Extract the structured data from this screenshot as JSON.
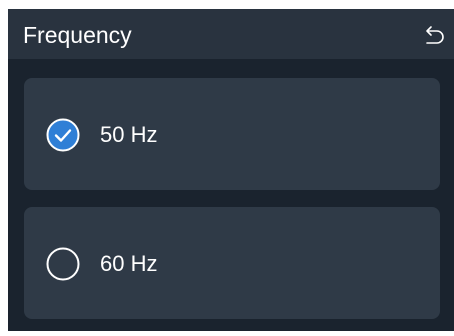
{
  "header": {
    "title": "Frequency",
    "back_icon": "back-arrow-icon"
  },
  "options": [
    {
      "label": "50 Hz",
      "selected": true
    },
    {
      "label": "60 Hz",
      "selected": false
    }
  ],
  "colors": {
    "background": "#1a232e",
    "header": "#29333f",
    "card": "#2f3a47",
    "accent": "#2f7fd6",
    "text": "#ffffff"
  }
}
